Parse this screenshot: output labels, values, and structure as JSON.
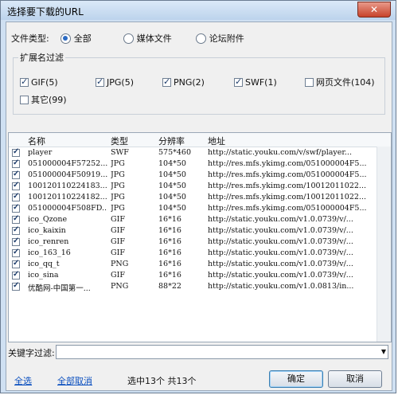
{
  "window": {
    "title": "选择要下载的URL",
    "close": "✕"
  },
  "file_type": {
    "label": "文件类型:",
    "options": [
      {
        "label": "全部",
        "selected": true
      },
      {
        "label": "媒体文件",
        "selected": false
      },
      {
        "label": "论坛附件",
        "selected": false
      }
    ]
  },
  "ext_filter": {
    "legend": "扩展名过滤",
    "items": [
      {
        "label": "GIF(5)",
        "checked": true
      },
      {
        "label": "JPG(5)",
        "checked": true
      },
      {
        "label": "PNG(2)",
        "checked": true
      },
      {
        "label": "SWF(1)",
        "checked": true
      },
      {
        "label": "网页文件(104)",
        "checked": false
      },
      {
        "label": "其它(99)",
        "checked": false
      }
    ]
  },
  "table": {
    "headers": [
      "名称",
      "类型",
      "分辨率",
      "地址"
    ],
    "rows": [
      {
        "name": "player",
        "type": "SWF",
        "res": "575*460",
        "url": "http://static.youku.com/v/swf/player..."
      },
      {
        "name": "051000004F57252...",
        "type": "JPG",
        "res": "104*50",
        "url": "http://res.mfs.ykimg.com/051000004F5..."
      },
      {
        "name": "051000004F50919...",
        "type": "JPG",
        "res": "104*50",
        "url": "http://res.mfs.ykimg.com/051000004F5..."
      },
      {
        "name": "100120110224183...",
        "type": "JPG",
        "res": "104*50",
        "url": "http://res.mfs.ykimg.com/10012011022..."
      },
      {
        "name": "100120110224182...",
        "type": "JPG",
        "res": "104*50",
        "url": "http://res.mfs.ykimg.com/10012011022..."
      },
      {
        "name": "051000004F508FD...",
        "type": "JPG",
        "res": "104*50",
        "url": "http://res.mfs.ykimg.com/051000004F5..."
      },
      {
        "name": "ico_Qzone",
        "type": "GIF",
        "res": "16*16",
        "url": "http://static.youku.com/v1.0.0739/v/..."
      },
      {
        "name": "ico_kaixin",
        "type": "GIF",
        "res": "16*16",
        "url": "http://static.youku.com/v1.0.0739/v/..."
      },
      {
        "name": "ico_renren",
        "type": "GIF",
        "res": "16*16",
        "url": "http://static.youku.com/v1.0.0739/v/..."
      },
      {
        "name": "ico_163_16",
        "type": "GIF",
        "res": "16*16",
        "url": "http://static.youku.com/v1.0.0739/v/..."
      },
      {
        "name": "ico_qq_t",
        "type": "PNG",
        "res": "16*16",
        "url": "http://static.youku.com/v1.0.0739/v/..."
      },
      {
        "name": "ico_sina",
        "type": "GIF",
        "res": "16*16",
        "url": "http://static.youku.com/v1.0.0739/v/..."
      },
      {
        "name": "优酷网-中国第一...",
        "type": "PNG",
        "res": "88*22",
        "url": "http://static.youku.com/v1.0.0813/in..."
      }
    ]
  },
  "keyword": {
    "label": "关键字过滤:",
    "value": ""
  },
  "footer": {
    "select_all": "全选",
    "deselect_all": "全部取消",
    "status": "选中13个 共13个",
    "ok": "确定",
    "cancel": "取消"
  }
}
